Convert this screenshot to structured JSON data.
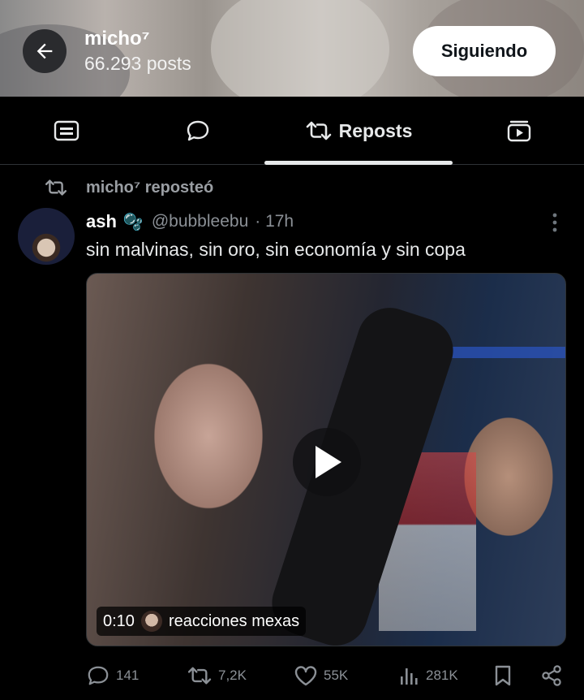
{
  "header": {
    "profile_name": "micho⁷",
    "posts_count": "66.293 posts",
    "follow_button": "Siguiendo"
  },
  "tabs": [
    {
      "name": "highlights",
      "icon": "card-icon",
      "label": ""
    },
    {
      "name": "replies",
      "icon": "speech-bubble-icon",
      "label": ""
    },
    {
      "name": "reposts",
      "icon": "repost-icon",
      "label": "Reposts",
      "active": true
    },
    {
      "name": "media",
      "icon": "video-library-icon",
      "label": ""
    }
  ],
  "repost_notice": "micho⁷ reposteó",
  "post": {
    "author": "ash",
    "author_emoji": "🫧",
    "handle": "@bubbleebu",
    "time": "· 17h",
    "text": "sin malvinas, sin oro, sin economía y sin copa",
    "video": {
      "duration": "0:10",
      "source": "reacciones mexas"
    },
    "stats": {
      "replies": "141",
      "reposts": "7,2K",
      "likes": "55K",
      "views": "281K"
    }
  },
  "colors": {
    "background": "#000000",
    "text": "#e7e9ea",
    "muted": "#8b9096",
    "divider": "#2f3336"
  }
}
